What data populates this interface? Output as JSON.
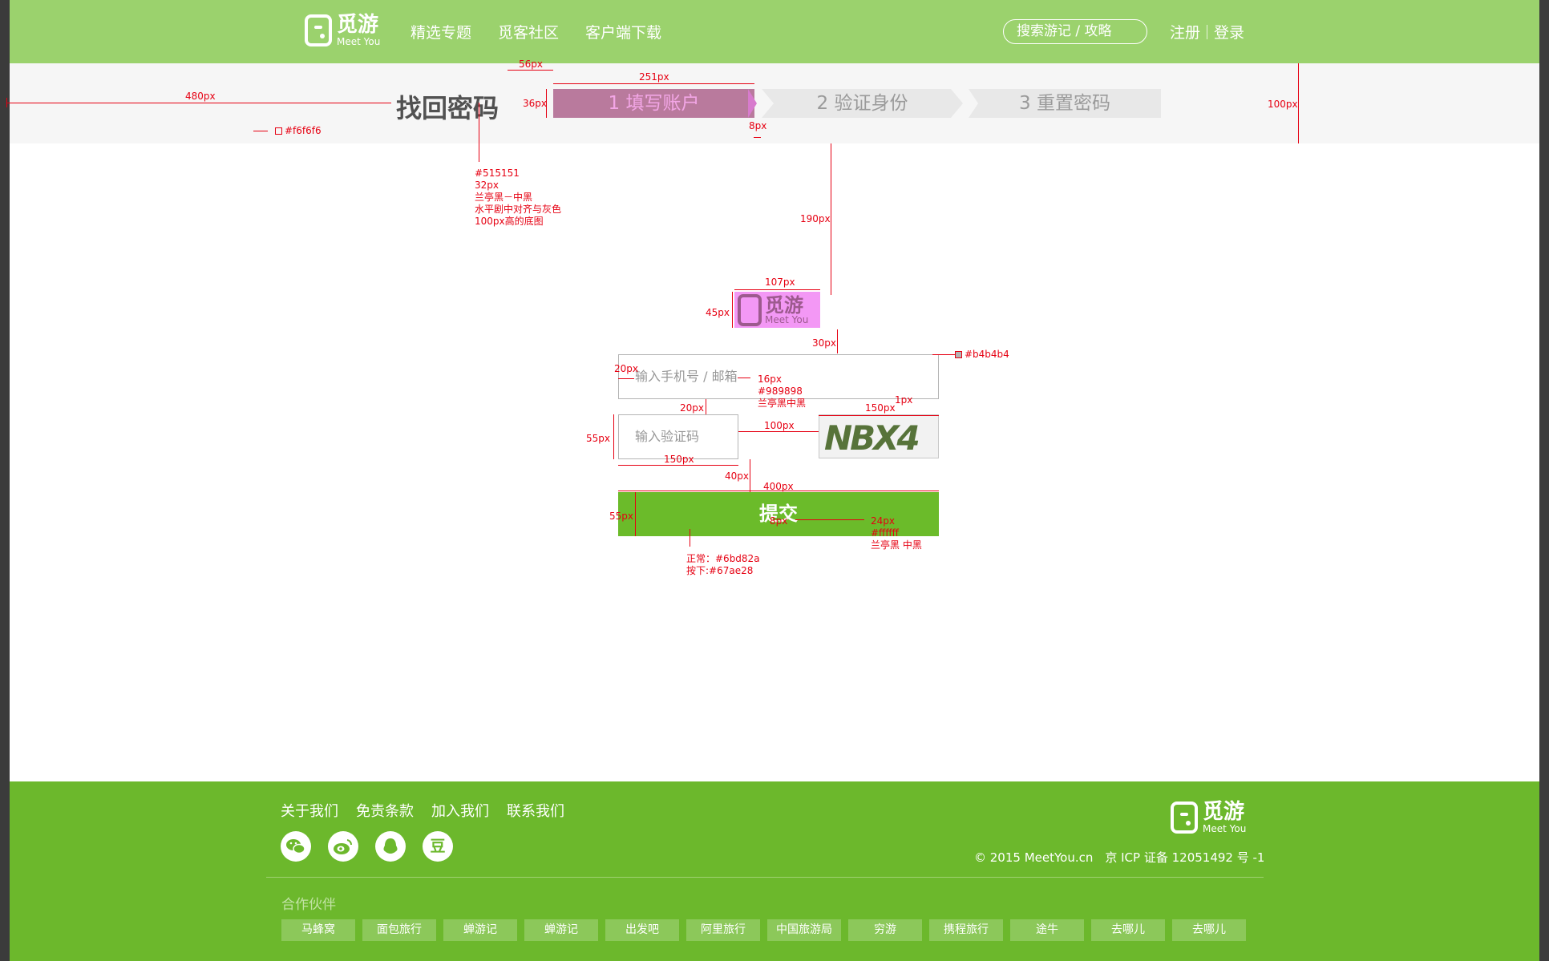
{
  "colors": {
    "header_bg": "#9bd26d",
    "steps_bg": "#f6f6f6",
    "title": "#515151",
    "input_border": "#b4b4b4",
    "placeholder": "#989898",
    "submit_normal": "#6bd82a",
    "submit_pressed": "#67ae28",
    "footer_bg": "#6cb82c"
  },
  "header": {
    "logo_cn": "觅游",
    "logo_en": "Meet You",
    "nav": [
      "精选专题",
      "觅客社区",
      "客户端下载"
    ],
    "search_placeholder": "搜索游记 / 攻略",
    "register": "注册",
    "login": "登录"
  },
  "steps": {
    "title": "找回密码",
    "items": [
      "1 填写账户",
      "2 验证身份",
      "3 重置密码"
    ]
  },
  "form": {
    "logo_cn": "觅游",
    "logo_en": "Meet You",
    "account_placeholder": "输入手机号 / 邮箱",
    "code_placeholder": "输入验证码",
    "captcha_text": "NBX4",
    "submit_label": "提交"
  },
  "annotations": {
    "w480": "480px",
    "bg_color": "#f6f6f6",
    "w56": "56px",
    "w251": "251px",
    "h36": "36px",
    "w8a": "8px",
    "h100": "100px",
    "title_spec": [
      "#515151",
      "32px",
      "兰亭黑－中黑",
      "水平剧中对齐与灰色",
      "100px高的底图"
    ],
    "h190": "190px",
    "w107": "107px",
    "h45": "45px",
    "h30": "30px",
    "border_color": "#b4b4b4",
    "pad20a": "20px",
    "input_spec": [
      "16px",
      "#989898",
      "兰亭黑中黑"
    ],
    "w1": "1px",
    "w150a": "150px",
    "h20": "20px",
    "h55a": "55px",
    "w100": "100px",
    "w150b": "150px",
    "h40": "40px",
    "w400": "400px",
    "h55b": "55px",
    "w8b": "8px",
    "submit_text_spec": [
      "24px",
      "#ffffff",
      "兰亭黑 中黑"
    ],
    "submit_color_spec": [
      "正常：#6bd82a",
      "按下:#67ae28"
    ]
  },
  "footer": {
    "links": [
      "关于我们",
      "免责条款",
      "加入我们",
      "联系我们"
    ],
    "social": [
      "wechat-icon",
      "weibo-icon",
      "qq-icon",
      "douban-icon"
    ],
    "douban_glyph": "豆",
    "logo_cn": "觅游",
    "logo_en": "Meet You",
    "copyright": "© 2015 MeetYou.cn　京 ICP 证备 12051492 号 -1",
    "partners_title": "合作伙伴",
    "partners": [
      "马蜂窝",
      "面包旅行",
      "蝉游记",
      "蝉游记",
      "出发吧",
      "阿里旅行",
      "中国旅游局",
      "穷游",
      "携程旅行",
      "途牛",
      "去哪儿",
      "去哪儿"
    ]
  }
}
